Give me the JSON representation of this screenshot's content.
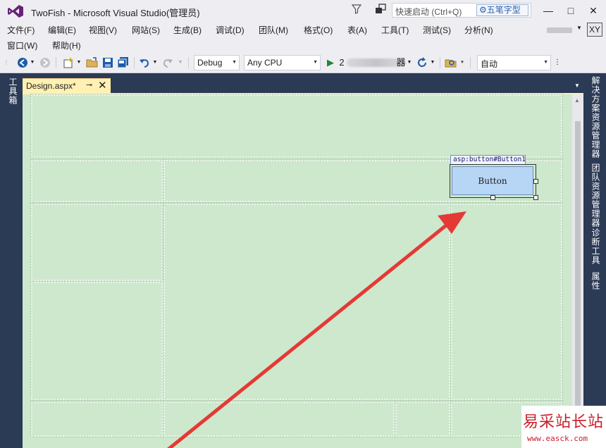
{
  "window": {
    "title": "TwoFish - Microsoft Visual Studio(管理员)",
    "quick_launch_placeholder": "快速启动 (Ctrl+Q)",
    "ime_label": "五笔字型",
    "min_label": "—",
    "max_label": "□",
    "close_label": "✕"
  },
  "menu": {
    "row1": [
      "文件(F)",
      "编辑(E)",
      "视图(V)",
      "网站(S)",
      "生成(B)",
      "调试(D)",
      "团队(M)",
      "格式(O)",
      "表(A)",
      "工具(T)",
      "测试(S)",
      "分析(N)"
    ],
    "row2": [
      "窗口(W)",
      "帮助(H)"
    ],
    "account_initials": "XY"
  },
  "toolbar": {
    "config": "Debug",
    "platform": "Any CPU",
    "run_prefix": "2",
    "run_suffix": "器",
    "layout": "自动"
  },
  "left_panel": {
    "toolbox": "工具箱"
  },
  "right_panel": {
    "solution_explorer": "解决方案资源管理器",
    "team_explorer": "团队资源管理器",
    "diagnostics": "诊断工具",
    "properties": "属性"
  },
  "document": {
    "tab_label": "Design.aspx*",
    "pin_icon": "⊸",
    "close_icon": "✕"
  },
  "designer": {
    "control_tag": "asp:button#Button1",
    "button_text": "Button"
  },
  "watermark": {
    "text": "易采站长站",
    "url": "www.easck.com"
  },
  "colors": {
    "accent": "#68217a",
    "arrow": "#e53935",
    "surface": "#cde8cd",
    "tab": "#fff1b3"
  }
}
